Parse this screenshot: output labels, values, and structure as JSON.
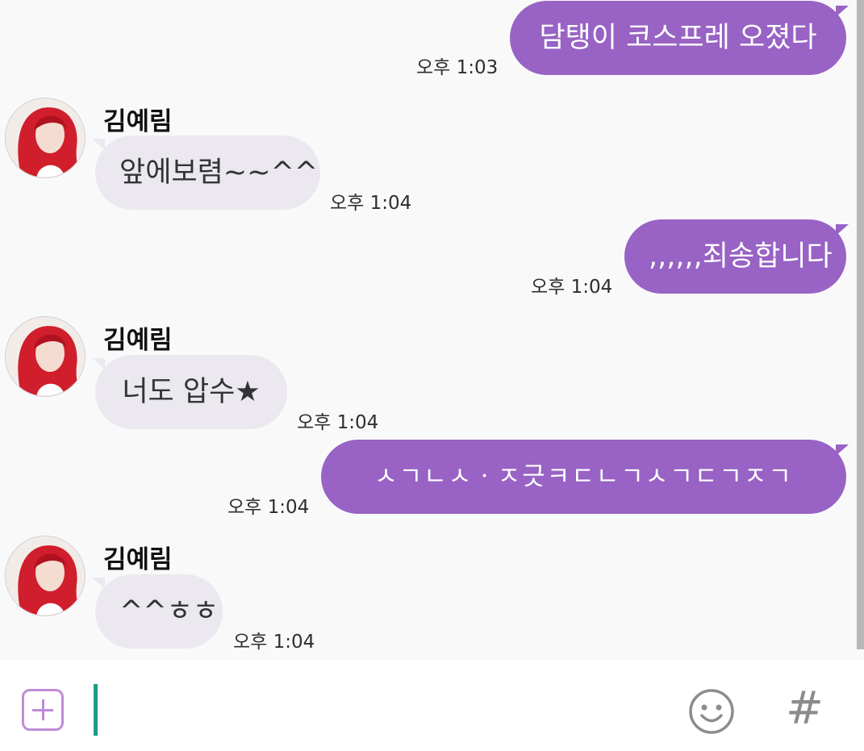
{
  "messages": [
    {
      "side": "out",
      "text": "담탱이 코스프레 오졌다",
      "time": "오후 1:03"
    },
    {
      "side": "in",
      "sender": "김예림",
      "text": "앞에보렴~~^^",
      "time": "오후 1:04"
    },
    {
      "side": "out",
      "text": ",,,,,,죄송합니다",
      "time": "오후 1:04"
    },
    {
      "side": "in",
      "sender": "김예림",
      "text": "너도 압수★",
      "time": "오후 1:04"
    },
    {
      "side": "out",
      "text": "ㅅㄱㄴㅅㆍㅈ긋ㅋㄷㄴㄱㅅㄱㄷㄱㅈㄱ",
      "time": "오후 1:04"
    },
    {
      "side": "in",
      "sender": "김예림",
      "text": "^^ㅎㅎ",
      "time": "오후 1:04"
    }
  ],
  "input": {
    "value": "",
    "plus_icon": "plus-square-icon",
    "emoji_icon": "smiley-icon",
    "hash_icon": "hashtag-icon",
    "hash_glyph": "#"
  },
  "colors": {
    "outgoing_bubble": "#9863c4",
    "incoming_bubble": "#ebe9ef",
    "accent": "#c08bd8",
    "cursor": "#1e9a88"
  }
}
